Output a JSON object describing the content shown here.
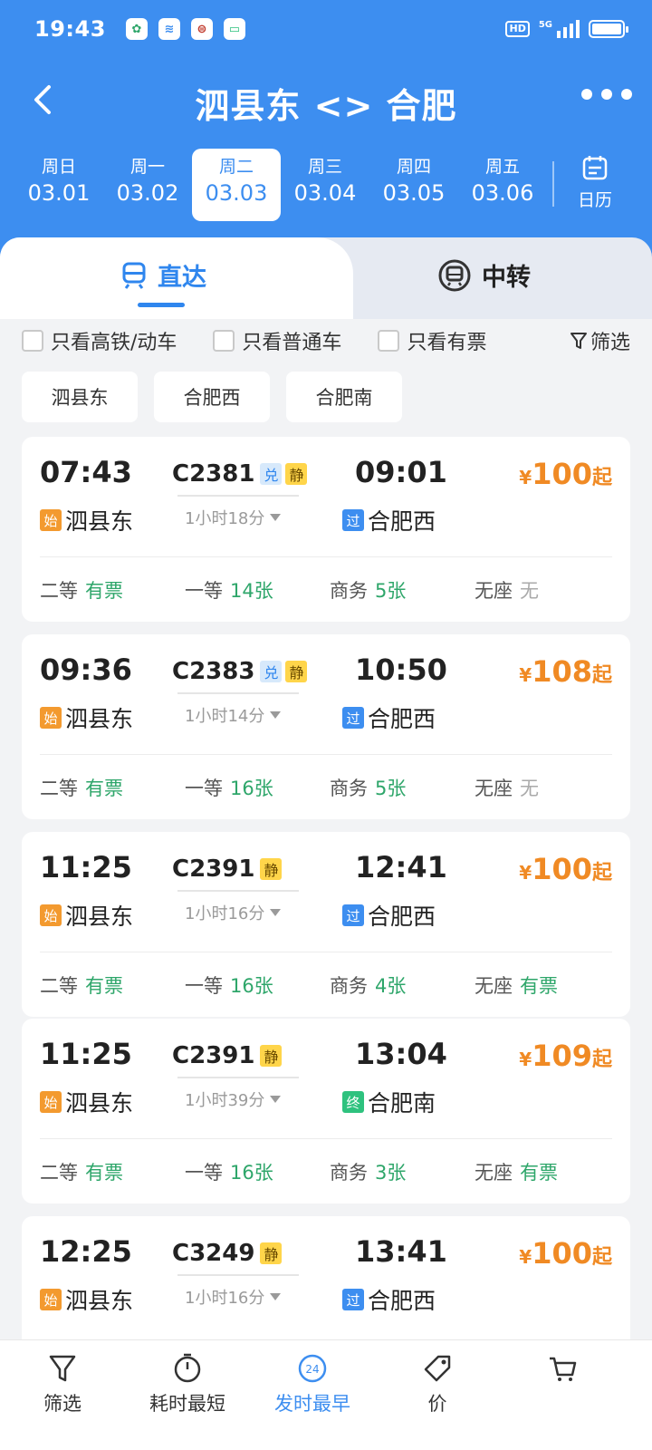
{
  "status_bar": {
    "time": "19:43",
    "hd": "HD",
    "network": "5G"
  },
  "header": {
    "title": "泗县东 <> 合肥"
  },
  "dates": [
    {
      "dow": "周日",
      "date": "03.01",
      "active": false
    },
    {
      "dow": "周一",
      "date": "03.02",
      "active": false
    },
    {
      "dow": "周二",
      "date": "03.03",
      "active": true
    },
    {
      "dow": "周三",
      "date": "03.04",
      "active": false
    },
    {
      "dow": "周四",
      "date": "03.05",
      "active": false
    },
    {
      "dow": "周五",
      "date": "03.06",
      "active": false
    }
  ],
  "calendar_label": "日历",
  "tabs": {
    "direct": "直达",
    "transfer": "中转"
  },
  "filters": {
    "highspeed_only": "只看高铁/动车",
    "normal_only": "只看普通车",
    "available_only": "只看有票",
    "filter": "筛选"
  },
  "stations": [
    "泗县东",
    "合肥西",
    "合肥南"
  ],
  "trains": [
    {
      "dep": "07:43",
      "train": "C2381",
      "tags": [
        "兑",
        "静"
      ],
      "arr": "09:01",
      "price_cur": "¥",
      "price": "100",
      "price_suffix": "起",
      "from_tag": "始",
      "from": "泗县东",
      "duration": "1小时18分",
      "to_tag": "过",
      "to": "合肥西",
      "seats": [
        {
          "name": "二等",
          "val": "有票"
        },
        {
          "name": "一等",
          "val": "14张"
        },
        {
          "name": "商务",
          "val": "5张"
        },
        {
          "name": "无座",
          "val": "无"
        }
      ]
    },
    {
      "dep": "09:36",
      "train": "C2383",
      "tags": [
        "兑",
        "静"
      ],
      "arr": "10:50",
      "price_cur": "¥",
      "price": "108",
      "price_suffix": "起",
      "from_tag": "始",
      "from": "泗县东",
      "duration": "1小时14分",
      "to_tag": "过",
      "to": "合肥西",
      "seats": [
        {
          "name": "二等",
          "val": "有票"
        },
        {
          "name": "一等",
          "val": "16张"
        },
        {
          "name": "商务",
          "val": "5张"
        },
        {
          "name": "无座",
          "val": "无"
        }
      ]
    },
    {
      "dep": "11:25",
      "train": "C2391",
      "tags": [
        "静"
      ],
      "arr": "12:41",
      "price_cur": "¥",
      "price": "100",
      "price_suffix": "起",
      "from_tag": "始",
      "from": "泗县东",
      "duration": "1小时16分",
      "to_tag": "过",
      "to": "合肥西",
      "seats": [
        {
          "name": "二等",
          "val": "有票"
        },
        {
          "name": "一等",
          "val": "16张"
        },
        {
          "name": "商务",
          "val": "4张"
        },
        {
          "name": "无座",
          "val": "有票"
        }
      ]
    },
    {
      "dep": "11:25",
      "train": "C2391",
      "tags": [
        "静"
      ],
      "arr": "13:04",
      "price_cur": "¥",
      "price": "109",
      "price_suffix": "起",
      "from_tag": "始",
      "from": "泗县东",
      "duration": "1小时39分",
      "to_tag": "终",
      "to": "合肥南",
      "seats": [
        {
          "name": "二等",
          "val": "有票"
        },
        {
          "name": "一等",
          "val": "16张"
        },
        {
          "name": "商务",
          "val": "3张"
        },
        {
          "name": "无座",
          "val": "有票"
        }
      ]
    },
    {
      "dep": "12:25",
      "train": "C3249",
      "tags": [
        "静"
      ],
      "arr": "13:41",
      "price_cur": "¥",
      "price": "100",
      "price_suffix": "起",
      "from_tag": "始",
      "from": "泗县东",
      "duration": "1小时16分",
      "to_tag": "过",
      "to": "合肥西",
      "seats": []
    }
  ],
  "bottom_bar": [
    {
      "label": "筛选",
      "icon": "filter-icon",
      "active": false
    },
    {
      "label": "耗时最短",
      "icon": "timer-icon",
      "active": false
    },
    {
      "label": "发时最早",
      "icon": "clock-24-icon",
      "active": true
    },
    {
      "label": "价",
      "icon": "price-tag-icon",
      "active": false
    },
    {
      "label": "",
      "icon": "cart-icon",
      "active": false
    }
  ],
  "colors": {
    "brand_blue": "#3d8ef0",
    "price_orange": "#f08a24",
    "available_green": "#2ea66a"
  }
}
